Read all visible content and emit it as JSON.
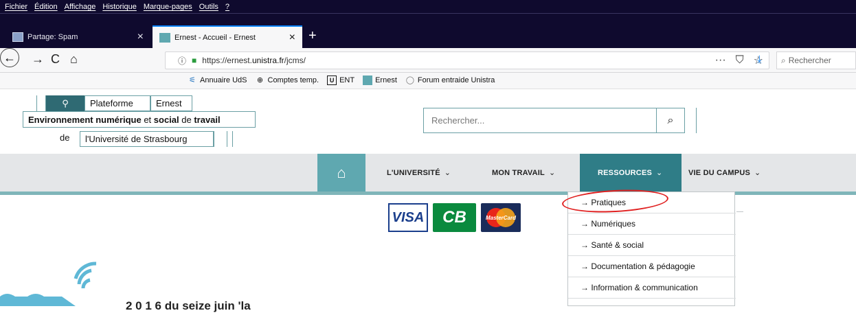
{
  "menubar": [
    "Fichier",
    "Édition",
    "Affichage",
    "Historique",
    "Marque-pages",
    "Outils",
    "?"
  ],
  "tabs": [
    {
      "label": "Partage: Spam"
    },
    {
      "label": "Ernest - Accueil - Ernest"
    }
  ],
  "url": {
    "prefix": "https://ernest.",
    "host": "unistra.fr",
    "path": "/jcms/"
  },
  "browser_search": {
    "placeholder": "Rechercher"
  },
  "bookmarks": [
    "Annuaire UdS",
    "Comptes temp.",
    "ENT",
    "Ernest",
    "Forum entraide Unistra"
  ],
  "logo": {
    "plateforme": "Plateforme",
    "ernest": "Ernest",
    "env_1": "Environnement numérique",
    "env_2": " et ",
    "env_3": "social",
    "env_4": " de ",
    "env_5": "travail",
    "de": "de",
    "univ": "l'Université de Strasbourg"
  },
  "site_search": {
    "placeholder": "Rechercher..."
  },
  "mainnav": [
    {
      "label": "L'UNIVERSITÉ"
    },
    {
      "label": "MON TRAVAIL"
    },
    {
      "label": "RESSOURCES"
    },
    {
      "label": "VIE DU CAMPUS"
    }
  ],
  "dropdown": [
    "→ Pratiques",
    "→ Numériques",
    "→ Santé & social",
    "→ Documentation & pédagogie",
    "→ Information & communication"
  ],
  "cards": {
    "visa": "VISA",
    "cb": "CB",
    "mastercard": "MasterCard"
  },
  "bottom": {
    "text": "2 0 1 6 du seize juin 'la"
  },
  "colors": {
    "accent": "#2f7d87",
    "home": "#5fa8b0",
    "annotation": "#e02020"
  }
}
